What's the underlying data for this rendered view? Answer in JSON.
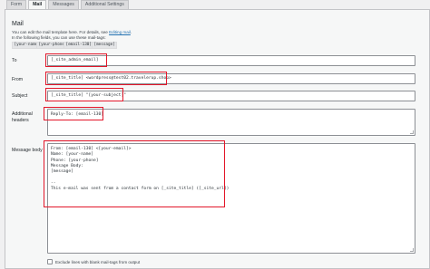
{
  "tabs": [
    {
      "label": "Form"
    },
    {
      "label": "Mail"
    },
    {
      "label": "Messages"
    },
    {
      "label": "Additional Settings"
    }
  ],
  "mail": {
    "heading": "Mail",
    "desc_line1_prefix": "You can edit the mail template here. For details, see",
    "desc_link": "Editing mail",
    "desc_line1_suffix": ".",
    "desc_line2": "In the following fields, you can use these mail-tags:",
    "mail_tags": [
      "[your-name]",
      "[your-phone]",
      "[email-130]",
      "[message]"
    ]
  },
  "fields": {
    "to": {
      "label": "To",
      "value": "[_site_admin_email]"
    },
    "from": {
      "label": "From",
      "value": "[_site_title] <wordpress@test02.travelerup.shop>"
    },
    "subject": {
      "label": "Subject",
      "value": "[_site_title] \"[your-subject]\""
    },
    "additional_headers": {
      "label_line1": "Additional",
      "label_line2": "headers",
      "value": "Reply-To: [email-130]"
    },
    "message_body": {
      "label": "Message body",
      "lines": [
        "From: [email-130] <[your-email]>",
        "Name: [your-name]",
        "Phone: [your-phone]",
        "Message Body:",
        "[message]",
        "",
        "--",
        "This e-mail was sent from a contact form on [_site_title] ([_site_url])"
      ]
    }
  },
  "options": {
    "exclude_blank_label": "Exclude lines with blank mail-tags from output"
  },
  "colors": {
    "highlight": "#e3172a",
    "link": "#2271b1"
  }
}
